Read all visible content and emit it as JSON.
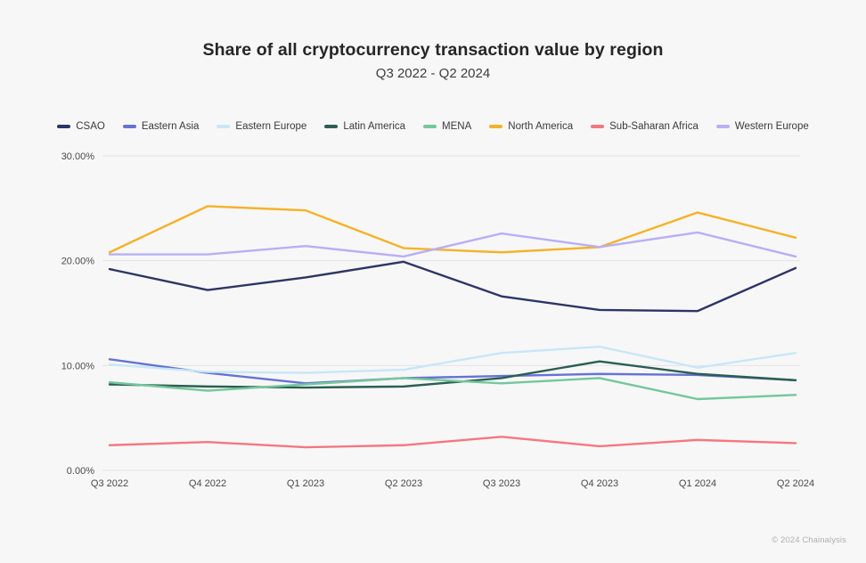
{
  "chart_data": {
    "type": "line",
    "title": "Share of all cryptocurrency transaction value by region",
    "subtitle": "Q3 2022 - Q2 2024",
    "xlabel": "",
    "ylabel": "",
    "ylim": [
      0,
      30
    ],
    "ytick_values": [
      0,
      10,
      20,
      30
    ],
    "ytick_labels": [
      "0.00%",
      "10.00%",
      "20.00%",
      "30.00%"
    ],
    "grid": true,
    "legend_position": "top-center",
    "categories": [
      "Q3 2022",
      "Q4 2022",
      "Q1 2023",
      "Q2 2023",
      "Q3 2023",
      "Q4 2023",
      "Q1 2024",
      "Q2 2024"
    ],
    "series": [
      {
        "name": "CSAO",
        "color": "#2d3565",
        "values": [
          19.2,
          17.2,
          18.4,
          19.9,
          16.6,
          15.3,
          15.2,
          19.3
        ]
      },
      {
        "name": "Eastern Asia",
        "color": "#6573d4",
        "values": [
          10.6,
          9.3,
          8.3,
          8.8,
          9.0,
          9.2,
          9.1,
          8.6
        ]
      },
      {
        "name": "Eastern Europe",
        "color": "#c7e7f7",
        "values": [
          10.1,
          9.4,
          9.3,
          9.6,
          11.2,
          11.8,
          9.8,
          11.2
        ]
      },
      {
        "name": "Latin America",
        "color": "#2c5e52",
        "values": [
          8.2,
          8.0,
          7.9,
          8.0,
          8.8,
          10.4,
          9.2,
          8.6
        ]
      },
      {
        "name": "MENA",
        "color": "#74c79c",
        "values": [
          8.4,
          7.6,
          8.2,
          8.8,
          8.3,
          8.8,
          6.8,
          7.2
        ]
      },
      {
        "name": "North America",
        "color": "#f5b229",
        "values": [
          20.8,
          25.2,
          24.8,
          21.2,
          20.8,
          21.3,
          24.6,
          22.2
        ]
      },
      {
        "name": "Sub-Saharan Africa",
        "color": "#f4787f",
        "values": [
          2.4,
          2.7,
          2.2,
          2.4,
          3.2,
          2.3,
          2.9,
          2.6
        ]
      },
      {
        "name": "Western Europe",
        "color": "#b8aff5",
        "values": [
          20.6,
          20.6,
          21.4,
          20.4,
          22.6,
          21.3,
          22.7,
          20.4
        ]
      }
    ]
  },
  "footer": {
    "credit": "© 2024 Chainalysis"
  }
}
